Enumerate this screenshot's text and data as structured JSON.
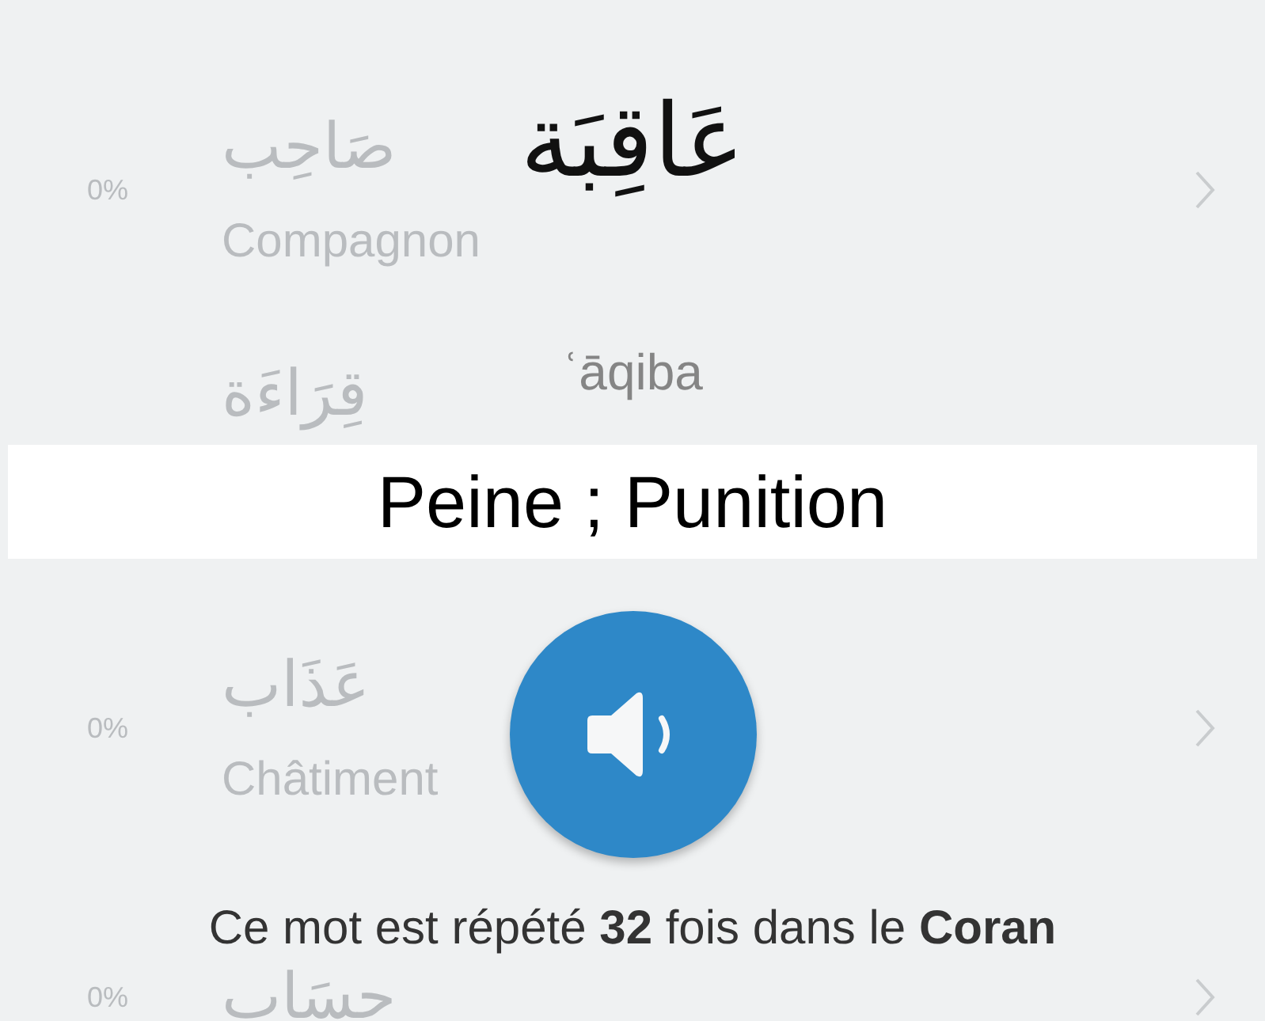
{
  "background_list": [
    {
      "arabic": "صَاحِب",
      "translation": "Compagnon",
      "percent": "0%"
    },
    {
      "arabic": "قِرَاءَة"
    },
    {
      "arabic": "عَذَاب",
      "translation": "Châtiment",
      "percent": "0%"
    },
    {
      "arabic": "حِسَاب",
      "percent": "0%"
    }
  ],
  "word_card": {
    "arabic": "عَاقِبَة",
    "transliteration": "ʿāqiba",
    "meaning": "Peine ; Punition",
    "occurrence": "Ce mot est répété **32** fois dans le **Coran**"
  }
}
